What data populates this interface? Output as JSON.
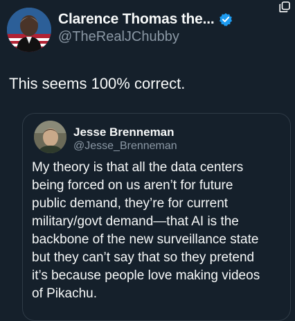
{
  "post": {
    "display_name": "Clarence Thomas the...",
    "handle": "@TheRealJChubby",
    "text": "This seems 100% correct."
  },
  "quoted_post": {
    "display_name": "Jesse Brenneman",
    "handle": "@Jesse_Brenneman",
    "lines": [
      "My theory is that all the data centers",
      "being forced on us aren’t for future",
      "public demand, they’re for current",
      "military/govt demand—that AI is the",
      "backbone of the new surveillance state",
      "but they can’t say that so they pretend",
      "it’s because people love making videos",
      "of Pikachu."
    ]
  },
  "icons": {
    "verified": "verified-badge-icon",
    "copy": "copy-icon"
  },
  "colors": {
    "background": "#15202b",
    "primary_text": "#f7f9f9",
    "secondary_text": "#8b98a5",
    "verified_blue": "#1d9bf0",
    "card_border": "#2f3b47"
  }
}
